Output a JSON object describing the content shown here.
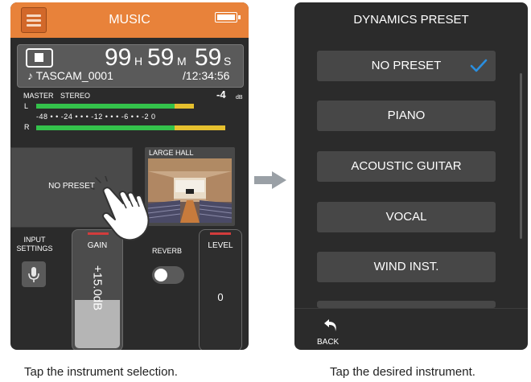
{
  "left_screen": {
    "title": "MUSIC",
    "counter": {
      "hours": "99",
      "hours_unit": "H",
      "minutes": "59",
      "minutes_unit": "M",
      "seconds": "59",
      "seconds_unit": "S",
      "file_name": "♪ TASCAM_0001",
      "total_time": "/12:34:56"
    },
    "meter": {
      "master_label": "MASTER",
      "mode_label": "STEREO",
      "db_value": "-4",
      "db_unit": "dB",
      "left_channel": "L",
      "right_channel": "R",
      "scale_text": "-48  •  •  -24  •  •  •  -12  •  •  •  -6  •  •  -2 0",
      "levels": {
        "left": 0.8,
        "right": 0.96
      }
    },
    "preset_area": {
      "text": "NO PRESET"
    },
    "reverb_preset": {
      "name": "LARGE HALL"
    },
    "input_settings": {
      "label_line1": "INPUT",
      "label_line2": "SETTINGS"
    },
    "gain": {
      "label": "GAIN",
      "value": "+15.0dB",
      "level": 0.42
    },
    "reverb": {
      "label": "REVERB",
      "enabled": false
    },
    "level": {
      "label": "LEVEL",
      "value": "0"
    }
  },
  "right_screen": {
    "title": "DYNAMICS PRESET",
    "items": [
      {
        "label": "NO PRESET",
        "selected": true
      },
      {
        "label": "PIANO",
        "selected": false
      },
      {
        "label": "ACOUSTIC GUITAR",
        "selected": false
      },
      {
        "label": "VOCAL",
        "selected": false
      },
      {
        "label": "WIND INST.",
        "selected": false
      },
      {
        "label": "",
        "selected": false
      }
    ],
    "back_label": "BACK"
  },
  "captions": {
    "left": "Tap the instrument selection.",
    "right": "Tap the desired instrument."
  },
  "colors": {
    "header_orange": "#e8823a",
    "panel_dark": "#2b2b2b",
    "meter_green": "#34c24b",
    "meter_yellow": "#e6c02e",
    "check_blue": "#2a8fe0",
    "indicator_red": "#d23c3c"
  },
  "icons": [
    "menu-icon",
    "battery-icon",
    "stop-icon",
    "microphone-icon",
    "hand-pointer-icon",
    "arrow-right-icon",
    "checkmark-icon",
    "back-arrow-icon"
  ]
}
